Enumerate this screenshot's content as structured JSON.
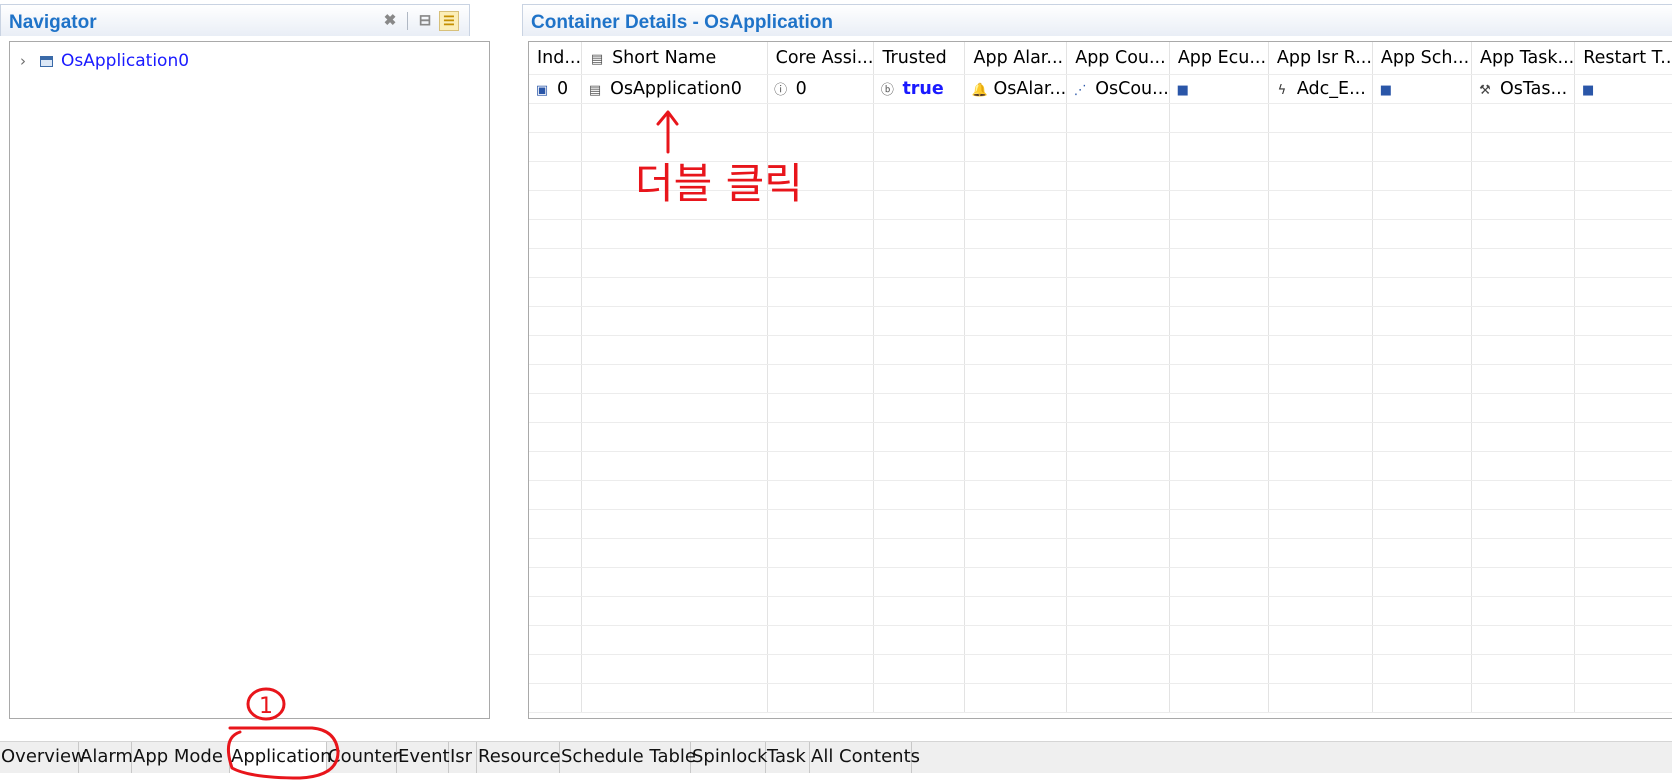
{
  "navigator": {
    "title": "Navigator",
    "tree": [
      {
        "label": "OsApplication0"
      }
    ],
    "icons": [
      "close-icon",
      "collapse-all-icon",
      "link-editor-icon"
    ]
  },
  "details": {
    "title": "Container Details - OsApplication",
    "columns": [
      "Ind...",
      "Short Name",
      "Core Assi...",
      "Trusted",
      "App Alar...",
      "App Cou...",
      "App Ecu...",
      "App Isr R...",
      "App Sch...",
      "App Task...",
      "Restart T..."
    ],
    "row": {
      "index": "0",
      "short_name": "OsApplication0",
      "core_assignment": "0",
      "trusted": "true",
      "app_alarm": "OsAlar...",
      "app_counter": "OsCou...",
      "app_ecuc": "",
      "app_isr": "Adc_E...",
      "app_schedule": "",
      "app_task": "OsTas...",
      "restart_task": ""
    }
  },
  "tabs": [
    "Overview",
    "Alarm",
    "App Mode",
    "Application",
    "Counter",
    "Event",
    "Isr",
    "Resource",
    "Schedule Table",
    "Spinlock",
    "Task",
    "All Contents"
  ],
  "selected_tab": "Application",
  "annotations": {
    "double_click_note": "더블 클릭",
    "step_number": "1"
  },
  "colors": {
    "title_blue": "#1f73c8",
    "link_blue": "#1a1aff",
    "annotation_red": "#e8151b"
  }
}
